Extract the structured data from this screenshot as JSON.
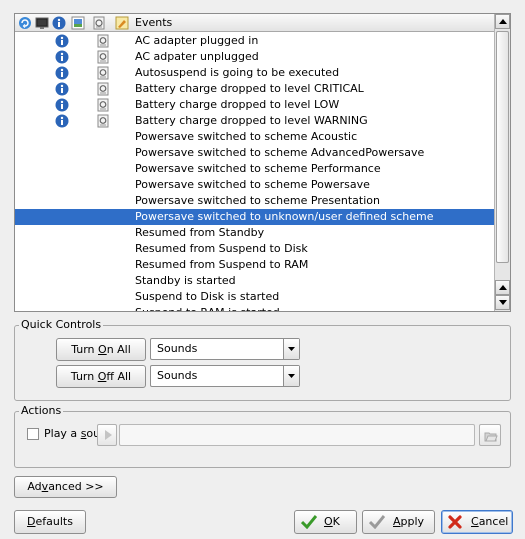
{
  "events_list": {
    "header_label": "Events",
    "header_icons": [
      "refresh-icon",
      "display-icon",
      "info-icon",
      "image-icon",
      "log-icon",
      "edit-icon"
    ],
    "rows": [
      {
        "text": "AC adapter plugged in",
        "info_icon": true,
        "log_icon": true,
        "selected": false
      },
      {
        "text": "AC adpater unplugged",
        "info_icon": true,
        "log_icon": true,
        "selected": false
      },
      {
        "text": "Autosuspend is going to be executed",
        "info_icon": true,
        "log_icon": true,
        "selected": false
      },
      {
        "text": "Battery charge dropped to level CRITICAL",
        "info_icon": true,
        "log_icon": true,
        "selected": false
      },
      {
        "text": "Battery charge dropped to level LOW",
        "info_icon": true,
        "log_icon": true,
        "selected": false
      },
      {
        "text": "Battery charge dropped to level WARNING",
        "info_icon": true,
        "log_icon": true,
        "selected": false
      },
      {
        "text": "Powersave switched to scheme Acoustic",
        "info_icon": false,
        "log_icon": false,
        "selected": false
      },
      {
        "text": "Powersave switched to scheme AdvancedPowersave",
        "info_icon": false,
        "log_icon": false,
        "selected": false
      },
      {
        "text": "Powersave switched to scheme Performance",
        "info_icon": false,
        "log_icon": false,
        "selected": false
      },
      {
        "text": "Powersave switched to scheme Powersave",
        "info_icon": false,
        "log_icon": false,
        "selected": false
      },
      {
        "text": "Powersave switched to scheme Presentation",
        "info_icon": false,
        "log_icon": false,
        "selected": false
      },
      {
        "text": "Powersave switched to unknown/user defined scheme",
        "info_icon": false,
        "log_icon": false,
        "selected": true
      },
      {
        "text": "Resumed from Standby",
        "info_icon": false,
        "log_icon": false,
        "selected": false
      },
      {
        "text": "Resumed from Suspend to Disk",
        "info_icon": false,
        "log_icon": false,
        "selected": false
      },
      {
        "text": "Resumed from Suspend to RAM",
        "info_icon": false,
        "log_icon": false,
        "selected": false
      },
      {
        "text": "Standby is started",
        "info_icon": false,
        "log_icon": false,
        "selected": false
      },
      {
        "text": "Suspend to Disk is started",
        "info_icon": false,
        "log_icon": false,
        "selected": false
      },
      {
        "text": "Suspend to RAM is started",
        "info_icon": false,
        "log_icon": false,
        "selected": false
      }
    ]
  },
  "quick_controls": {
    "title": "Quick Controls",
    "turn_on_all": {
      "pre": "Turn ",
      "mnemonic": "O",
      "post": "n All"
    },
    "turn_on_select": "Sounds",
    "turn_off_all": {
      "pre": "Turn ",
      "mnemonic": "O",
      "post": "ff All"
    },
    "turn_off_select": "Sounds"
  },
  "actions": {
    "title": "Actions",
    "play_sound": {
      "pre": "Play a ",
      "mnemonic": "s",
      "post": "ound:"
    },
    "play_sound_checked": false,
    "sound_path": ""
  },
  "advanced_button": {
    "pre": "Ad",
    "mnemonic": "v",
    "post": "anced >>"
  },
  "footer": {
    "defaults": {
      "pre": "",
      "mnemonic": "D",
      "post": "efaults"
    },
    "ok": {
      "pre": "",
      "mnemonic": "O",
      "post": "K"
    },
    "apply": {
      "pre": "",
      "mnemonic": "A",
      "post": "pply"
    },
    "cancel": {
      "pre": "",
      "mnemonic": "C",
      "post": "ancel"
    }
  },
  "colors": {
    "selection": "#2f6ec8",
    "info_icon": "#2b65b8",
    "ok_check": "#3a9a2a",
    "cancel_x": "#d02b1b",
    "window_bg": "#efefef"
  }
}
